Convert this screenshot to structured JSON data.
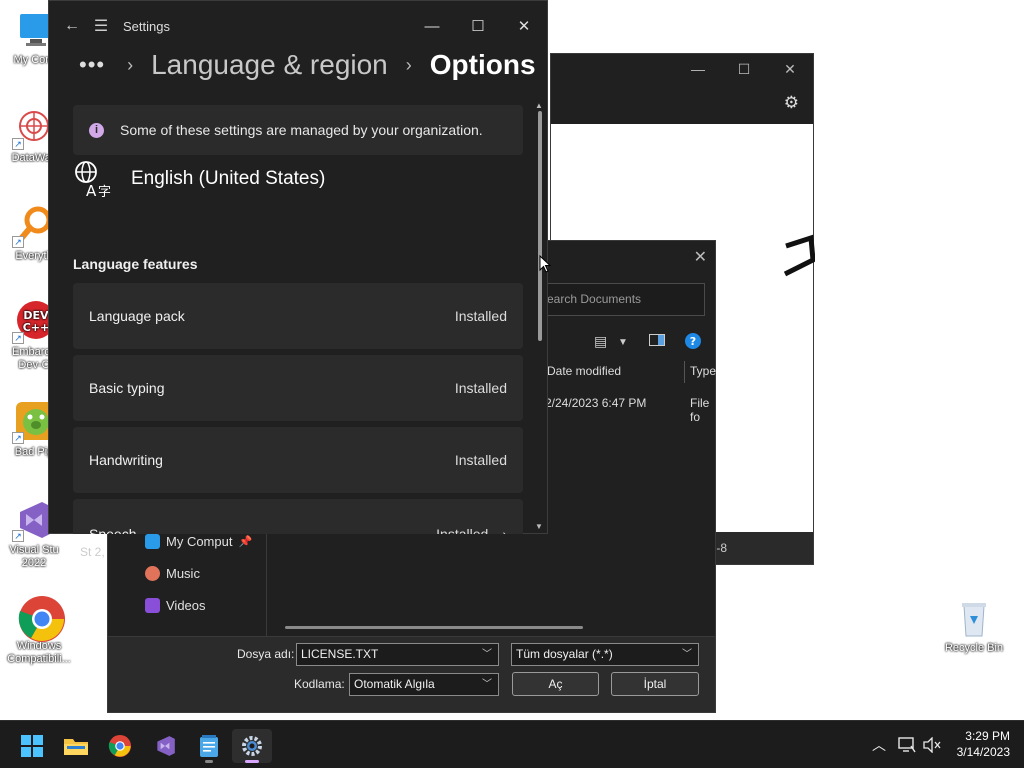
{
  "desktop": {
    "icons": [
      {
        "label": "My Com"
      },
      {
        "label": "DataWac"
      },
      {
        "label": "Everyth"
      },
      {
        "label": "Embarca\nDev-C"
      },
      {
        "label": "Bad Pig"
      },
      {
        "label": "Visual Stu\n2022"
      },
      {
        "label": "Windows\nCompatibili..."
      },
      {
        "label": "Recycle Bin"
      }
    ]
  },
  "notepad": {
    "status_left": "St 2,",
    "status_right": "-8"
  },
  "open_dialog": {
    "search_placeholder": "earch Documents",
    "columns": {
      "date_modified": "Date modified",
      "type": "Type"
    },
    "file_row": {
      "date": "2/24/2023 6:47 PM",
      "type": "File fo"
    },
    "nav": [
      {
        "label": "My Comput"
      },
      {
        "label": "Music"
      },
      {
        "label": "Videos"
      }
    ],
    "filename_label": "Dosya adı:",
    "filename_value": "LICENSE.TXT",
    "filetype_value": "Tüm dosyalar  (*.*)",
    "encoding_label": "Kodlama:",
    "encoding_value": "Otomatik Algıla",
    "open_button": "Aç",
    "cancel_button": "İptal"
  },
  "settings": {
    "window_title": "Settings",
    "breadcrumb": {
      "ellipsis": "•••",
      "parent": "Language & region",
      "current": "Options"
    },
    "info_message": "Some of these settings are managed by your organization.",
    "language_name": "English (United States)",
    "section_title": "Language features",
    "features": [
      {
        "name": "Language pack",
        "status": "Installed"
      },
      {
        "name": "Basic typing",
        "status": "Installed"
      },
      {
        "name": "Handwriting",
        "status": "Installed"
      },
      {
        "name": "Speech",
        "status": "Installed"
      }
    ]
  },
  "taskbar": {
    "time": "3:29 PM",
    "date": "3/14/2023",
    "apps": [
      "start-icon",
      "file-explorer-icon",
      "chrome-icon",
      "visual-studio-icon",
      "notepad-icon",
      "settings-icon"
    ]
  },
  "colors": {
    "accent": "#d9a7ff",
    "window_bg": "#202020",
    "card_bg": "#2b2b2b"
  }
}
